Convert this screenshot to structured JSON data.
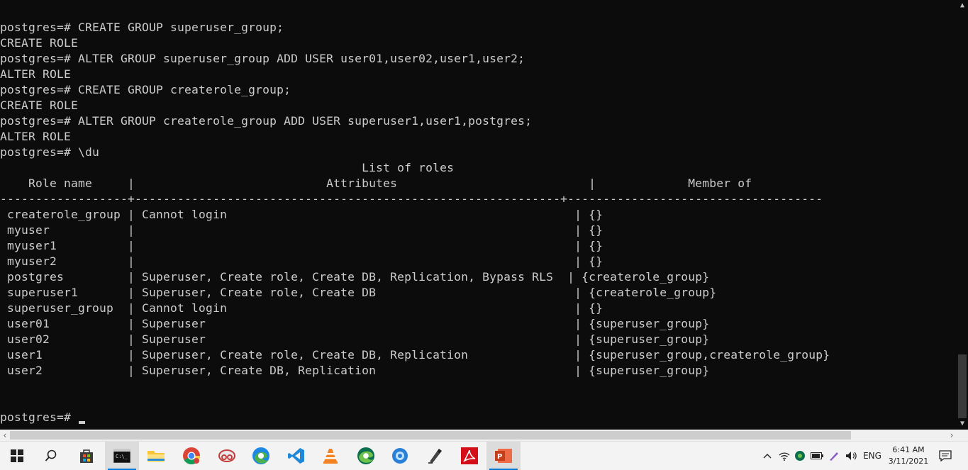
{
  "terminal": {
    "lines": [
      "postgres=# CREATE GROUP superuser_group;",
      "CREATE ROLE",
      "postgres=# ALTER GROUP superuser_group ADD USER user01,user02,user1,user2;",
      "ALTER ROLE",
      "postgres=# CREATE GROUP createrole_group;",
      "CREATE ROLE",
      "postgres=# ALTER GROUP createrole_group ADD USER superuser1,user1,postgres;",
      "ALTER ROLE",
      "postgres=# \\du",
      "                                                   List of roles",
      "    Role name     |                           Attributes                           |             Member of",
      "------------------+------------------------------------------------------------+------------------------------------",
      " createrole_group | Cannot login                                                 | {}",
      " myuser           |                                                              | {}",
      " myuser1          |                                                              | {}",
      " myuser2          |                                                              | {}",
      " postgres         | Superuser, Create role, Create DB, Replication, Bypass RLS  | {createrole_group}",
      " superuser1       | Superuser, Create role, Create DB                            | {createrole_group}",
      " superuser_group  | Cannot login                                                 | {}",
      " user01           | Superuser                                                    | {superuser_group}",
      " user02           | Superuser                                                    | {superuser_group}",
      " user1            | Superuser, Create role, Create DB, Replication               | {superuser_group,createrole_group}",
      " user2            | Superuser, Create DB, Replication                            | {superuser_group}",
      "",
      "",
      "postgres=# "
    ]
  },
  "taskbar": {
    "apps": [
      {
        "name": "start-button",
        "icon": "windows-logo-icon"
      },
      {
        "name": "search-button",
        "icon": "search-icon"
      },
      {
        "name": "store-app",
        "icon": "store-icon"
      },
      {
        "name": "cmd-app",
        "icon": "command-prompt-icon"
      },
      {
        "name": "file-explorer-app",
        "icon": "folder-icon"
      },
      {
        "name": "chrome-app",
        "icon": "chrome-icon"
      },
      {
        "name": "snipping-app",
        "icon": "snipping-tool-icon"
      },
      {
        "name": "edge-app",
        "icon": "edge-icon"
      },
      {
        "name": "vscode-app",
        "icon": "vscode-icon"
      },
      {
        "name": "vlc-app",
        "icon": "vlc-icon"
      },
      {
        "name": "edge-dev-app",
        "icon": "edge-dev-icon"
      },
      {
        "name": "cortana-app",
        "icon": "cortana-icon"
      },
      {
        "name": "pen-app",
        "icon": "pen-tool-icon"
      },
      {
        "name": "acrobat-app",
        "icon": "acrobat-icon"
      },
      {
        "name": "powerpoint-app",
        "icon": "powerpoint-icon"
      }
    ],
    "language": "ENG",
    "time": "6:41 AM",
    "date": "3/11/2021",
    "colors": {
      "accent": "#0078d7",
      "terminal_bg": "#0c0c0c",
      "terminal_fg": "#cccccc"
    }
  }
}
